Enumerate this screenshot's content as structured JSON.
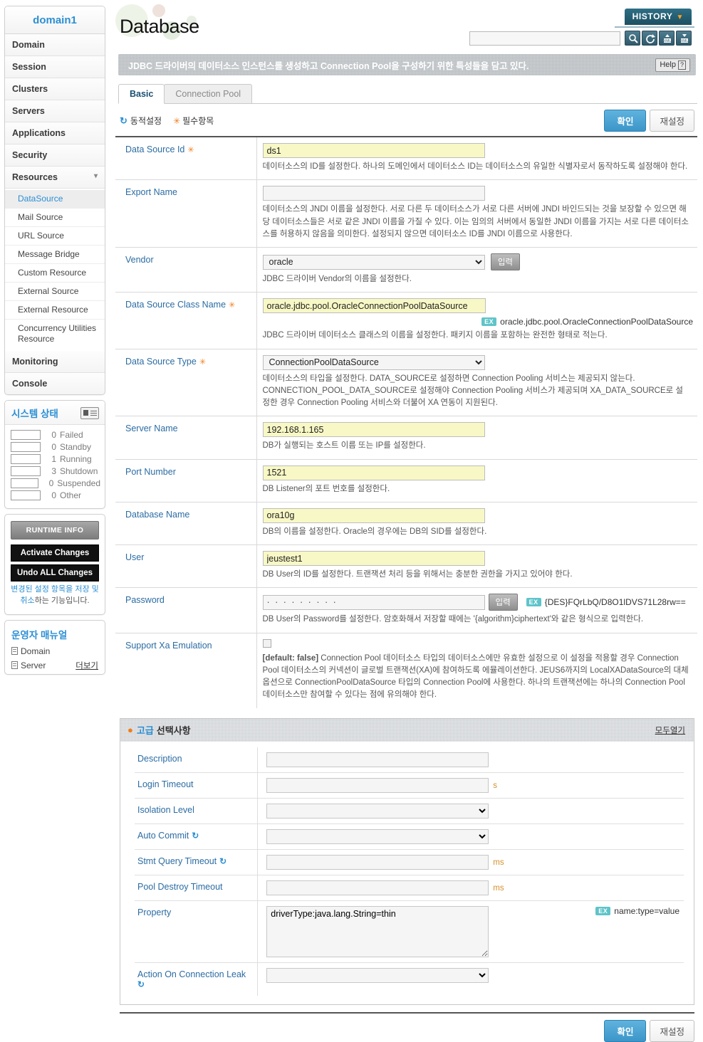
{
  "sidebar": {
    "domain_title": "domain1",
    "nav": [
      {
        "label": "Domain"
      },
      {
        "label": "Session"
      },
      {
        "label": "Clusters"
      },
      {
        "label": "Servers"
      },
      {
        "label": "Applications"
      },
      {
        "label": "Security"
      },
      {
        "label": "Resources",
        "expanded": true
      }
    ],
    "resources_children": [
      {
        "label": "DataSource",
        "active": true
      },
      {
        "label": "Mail Source",
        "active": false
      },
      {
        "label": "URL Source",
        "active": false
      },
      {
        "label": "Message Bridge",
        "active": false
      },
      {
        "label": "Custom Resource",
        "active": false
      },
      {
        "label": "External Source",
        "active": false
      },
      {
        "label": "External Resource",
        "active": false
      },
      {
        "label": "Concurrency Utilities Resource",
        "active": false
      }
    ],
    "nav_after": [
      {
        "label": "Monitoring"
      },
      {
        "label": "Console"
      }
    ],
    "status": {
      "title": "시스템 상태",
      "rows": [
        {
          "count": "0",
          "label": "Failed",
          "fill": "none"
        },
        {
          "count": "0",
          "label": "Standby",
          "fill": "none"
        },
        {
          "count": "1",
          "label": "Running",
          "fill": "green"
        },
        {
          "count": "3",
          "label": "Shutdown",
          "fill": "red"
        },
        {
          "count": "0",
          "label": "Suspended",
          "fill": "none"
        },
        {
          "count": "0",
          "label": "Other",
          "fill": "none"
        }
      ]
    },
    "buttons": {
      "runtime_info": "RUNTIME INFO",
      "activate_changes": "Activate Changes",
      "undo_all_changes": "Undo ALL Changes",
      "note_link": "변경된 설정 항목을 저장 및 취소",
      "note_tail": "하는 기능입니다."
    },
    "manual": {
      "title": "운영자 매뉴얼",
      "items": [
        {
          "label": "Domain"
        },
        {
          "label": "Server"
        }
      ],
      "more": "더보기"
    }
  },
  "header": {
    "page_title": "Database",
    "history_label": "HISTORY",
    "search_placeholder": "",
    "search_value": "",
    "toolbar_icons": [
      "search-icon",
      "refresh-icon",
      "xml-import-icon",
      "xml-export-icon"
    ],
    "info_text": "JDBC 드라이버의 데이터소스 인스턴스를 생성하고 Connection Pool을 구성하기 위한 특성들을 담고 있다.",
    "help_label": "Help"
  },
  "tabs": [
    {
      "label": "Basic",
      "active": true
    },
    {
      "label": "Connection Pool",
      "active": false
    }
  ],
  "legend": {
    "dynamic": "동적설정",
    "required": "필수항목"
  },
  "actions": {
    "ok": "확인",
    "reset": "재설정",
    "input": "입력"
  },
  "form": {
    "rows": [
      {
        "label": "Data Source Id",
        "required": true,
        "type": "text",
        "value": "ds1",
        "highlight": true,
        "desc": "데이터소스의 ID를 설정한다. 하나의 도메인에서 데이터소스 ID는 데이터소스의 유일한 식별자로서 동작하도록 설정해야 한다."
      },
      {
        "label": "Export Name",
        "required": false,
        "type": "text",
        "value": "",
        "highlight": false,
        "desc": "데이터소스의 JNDI 이름을 설정한다. 서로 다른 두 데이터소스가 서로 다른 서버에 JNDI 바인드되는 것을 보장할 수 있으면 해당 데이터소스들은 서로 같은 JNDI 이름을 가질 수 있다. 이는 임의의 서버에서 동일한 JNDI 이름을 가지는 서로 다른 데이터소스를 허용하지 않음을 의미한다. 설정되지 않으면 데이터소스 ID를 JNDI 이름으로 사용한다."
      },
      {
        "label": "Vendor",
        "required": false,
        "type": "select-input",
        "value": "oracle",
        "highlight": false,
        "desc": "JDBC 드라이버 Vendor의 이름을 설정한다."
      },
      {
        "label": "Data Source Class Name",
        "required": true,
        "type": "text",
        "value": "oracle.jdbc.pool.OracleConnectionPoolDataSource",
        "highlight": true,
        "example": "oracle.jdbc.pool.OracleConnectionPoolDataSource",
        "desc": "JDBC 드라이버 데이터소스 클래스의 이름을 설정한다. 패키지 이름을 포함하는 완전한 형태로 적는다."
      },
      {
        "label": "Data Source Type",
        "required": true,
        "type": "select",
        "value": "ConnectionPoolDataSource",
        "highlight": false,
        "desc": "데이터소스의 타입을 설정한다. DATA_SOURCE로 설정하면 Connection Pooling 서비스는 제공되지 않는다. CONNECTION_POOL_DATA_SOURCE로 설정해야 Connection Pooling 서비스가 제공되며 XA_DATA_SOURCE로 설정한 경우 Connection Pooling 서비스와 더불어 XA 연동이 지원된다."
      },
      {
        "label": "Server Name",
        "required": false,
        "type": "text",
        "value": "192.168.1.165",
        "highlight": true,
        "desc": "DB가 실행되는 호스트 이름 또는 IP를 설정한다."
      },
      {
        "label": "Port Number",
        "required": false,
        "type": "text",
        "value": "1521",
        "highlight": true,
        "desc": "DB Listener의 포트 번호를 설정한다."
      },
      {
        "label": "Database Name",
        "required": false,
        "type": "text",
        "value": "ora10g",
        "highlight": true,
        "desc": "DB의 이름을 설정한다. Oracle의 경우에는 DB의 SID를 설정한다."
      },
      {
        "label": "User",
        "required": false,
        "type": "text",
        "value": "jeustest1",
        "highlight": true,
        "desc": "DB User의 ID를 설정한다. 트랜잭션 처리 등을 위해서는 충분한 권한을 가지고 있어야 한다."
      },
      {
        "label": "Password",
        "required": false,
        "type": "password-input",
        "value": "· · · · · · · · ·",
        "highlight": false,
        "example": "{DES}FQrLbQ/D8O1lDVS71L28rw==",
        "desc": "DB User의 Password를 설정한다. 암호화해서 저장할 때에는 '{algorithm}ciphertext'와 같은 형식으로 입력한다."
      },
      {
        "label": "Support Xa Emulation",
        "required": false,
        "type": "checkbox",
        "checked": false,
        "desc_bold": "[default: false]",
        "desc": "Connection Pool 데이터소스 타입의 데이터소스에만 유효한 설정으로 이 설정을 적용할 경우 Connection Pool 데이터소스의 커넥션이 글로벌 트랜잭션(XA)에 참여하도록 에뮬레이션한다. JEUS6까지의 LocalXADataSource의 대체 옵션으로 ConnectionPoolDataSource 타입의 Connection Pool에 사용한다. 하나의 트랜잭션에는 하나의 Connection Pool 데이터소스만 참여할 수 있다는 점에 유의해야 한다."
      }
    ]
  },
  "advanced": {
    "title_prefix": "고급",
    "title_suffix": "선택사항",
    "open_all": "모두열기",
    "rows": [
      {
        "label": "Description",
        "type": "text",
        "value": "",
        "unit": "",
        "dynamic": false
      },
      {
        "label": "Login Timeout",
        "type": "text",
        "value": "",
        "unit": "s",
        "dynamic": false
      },
      {
        "label": "Isolation Level",
        "type": "select",
        "value": "",
        "unit": "",
        "dynamic": false
      },
      {
        "label": "Auto Commit",
        "type": "select",
        "value": "",
        "unit": "",
        "dynamic": true
      },
      {
        "label": "Stmt Query Timeout",
        "type": "text",
        "value": "",
        "unit": "ms",
        "dynamic": true
      },
      {
        "label": "Pool Destroy Timeout",
        "type": "text",
        "value": "",
        "unit": "ms",
        "dynamic": false
      },
      {
        "label": "Property",
        "type": "textarea",
        "value": "driverType:java.lang.String=thin",
        "hint": "name:type=value",
        "dynamic": false
      },
      {
        "label": "Action On Connection Leak",
        "type": "select",
        "value": "",
        "unit": "",
        "dynamic": true
      }
    ]
  }
}
